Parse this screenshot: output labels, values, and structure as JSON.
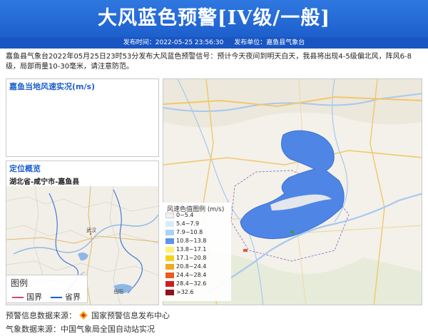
{
  "header": {
    "title": "大风蓝色预警[IV级/一般]",
    "publish_time_label": "发布时间：2022-05-25 23:56:30",
    "publish_unit_label": "发布单位：嘉鱼县气象台"
  },
  "warning": {
    "text": "嘉鱼县气象台2022年05月25日23时53分发布大风蓝色预警信号：预计今天夜间到明天白天，我县将出现4-5级偏北风，阵风6-8级，局部雨量10-30毫米，请注意防范。"
  },
  "wind_panel": {
    "title": "嘉鱼当地风速实况(m/s)"
  },
  "location_panel": {
    "title": "定位概览",
    "region": "湖北省-咸宁市-嘉鱼县",
    "place_label": "武汉",
    "place_label_2": "岳阳"
  },
  "small_legend": {
    "title": "图例",
    "items": [
      {
        "label": "国界",
        "color": "#c84b6b"
      },
      {
        "label": "省界",
        "color": "#1d5fcc"
      }
    ]
  },
  "wind_legend": {
    "title": "风速色值图例 (m/s)",
    "items": [
      {
        "label": "0~5.4",
        "color": "#f2f2f2"
      },
      {
        "label": "5.4~7.9",
        "color": "#d6ecfb"
      },
      {
        "label": "7.9~10.8",
        "color": "#a9d2f7"
      },
      {
        "label": "10.8~13.8",
        "color": "#5b94ec"
      },
      {
        "label": "13.8~17.1",
        "color": "#fff176"
      },
      {
        "label": "17.1~20.8",
        "color": "#f5d21b"
      },
      {
        "label": "20.8~24.4",
        "color": "#f5a623"
      },
      {
        "label": "24.4~28.4",
        "color": "#ea5b1e"
      },
      {
        "label": "28.4~32.6",
        "color": "#c9201c"
      },
      {
        "label": ">32.6",
        "color": "#8a1416"
      }
    ]
  },
  "footer": {
    "warning_source": "预警信息数据来源：",
    "warning_source_name": "国家预警信息发布中心",
    "weather_source": "气象数据来源：中国气象局全国自动站实况"
  }
}
